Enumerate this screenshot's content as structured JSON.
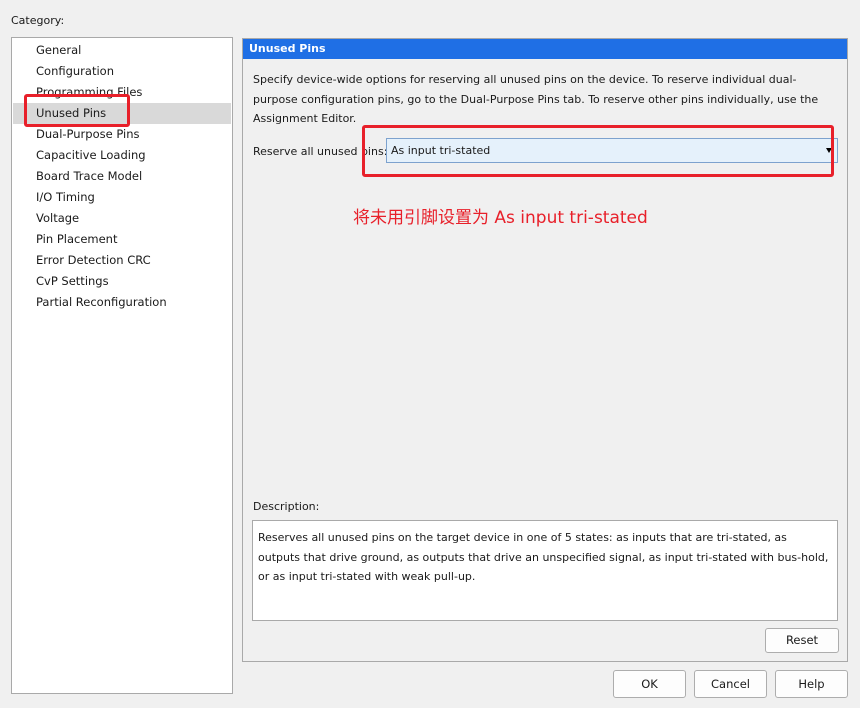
{
  "category_label": "Category:",
  "categories": [
    {
      "label": "General",
      "selected": false
    },
    {
      "label": "Configuration",
      "selected": false
    },
    {
      "label": "Programming Files",
      "selected": false
    },
    {
      "label": "Unused Pins",
      "selected": true
    },
    {
      "label": "Dual-Purpose Pins",
      "selected": false
    },
    {
      "label": "Capacitive Loading",
      "selected": false
    },
    {
      "label": "Board Trace Model",
      "selected": false
    },
    {
      "label": "I/O Timing",
      "selected": false
    },
    {
      "label": "Voltage",
      "selected": false
    },
    {
      "label": "Pin Placement",
      "selected": false
    },
    {
      "label": "Error Detection CRC",
      "selected": false
    },
    {
      "label": "CvP Settings",
      "selected": false
    },
    {
      "label": "Partial Reconfiguration",
      "selected": false
    }
  ],
  "panel": {
    "title": "Unused Pins",
    "intro": "Specify device-wide options for reserving all unused pins on the device. To reserve individual dual-purpose configuration pins, go to the Dual-Purpose Pins tab. To reserve other pins individually, use the Assignment Editor.",
    "reserve_label": "Reserve all unused pins:",
    "reserve_value": "As input tri-stated",
    "annotation": "将未用引脚设置为 As input tri-stated",
    "description_label": "Description:",
    "description_text": "Reserves all unused pins on the target device in one of 5 states: as inputs that are tri-stated, as outputs that drive ground, as outputs that drive an unspecified signal, as input tri-stated with bus-hold, or as input tri-stated with weak pull-up.",
    "reset_label": "Reset"
  },
  "buttons": {
    "ok": "OK",
    "cancel": "Cancel",
    "help": "Help"
  },
  "colors": {
    "header_bg": "#1f6fe5",
    "annotation_red": "#e8202a",
    "selected_bg": "#d9d9d9"
  }
}
